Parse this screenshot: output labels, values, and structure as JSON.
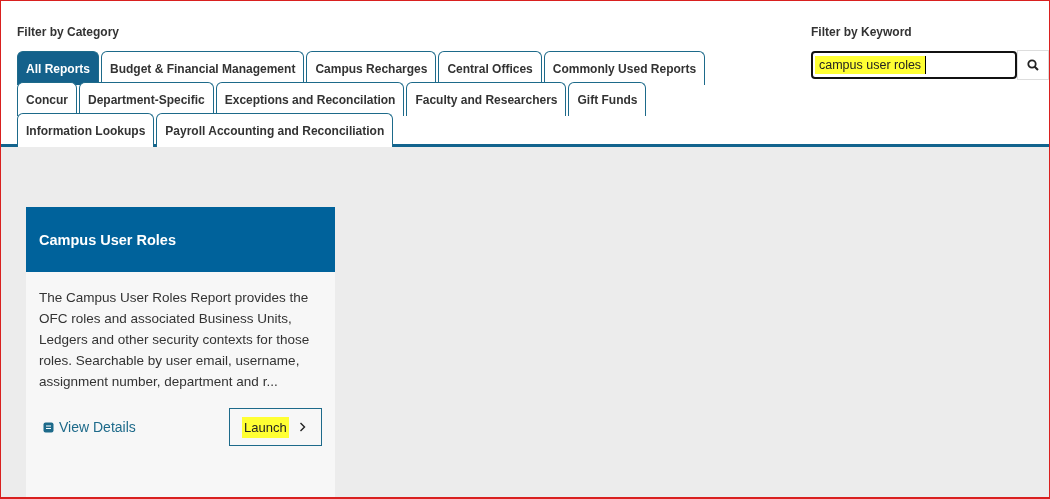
{
  "category_filter": {
    "label": "Filter by Category",
    "tabs": [
      {
        "label": "All Reports",
        "selected": true
      },
      {
        "label": "Budget & Financial Management",
        "selected": false
      },
      {
        "label": "Campus Recharges",
        "selected": false
      },
      {
        "label": "Central Offices",
        "selected": false
      },
      {
        "label": "Commonly Used Reports",
        "selected": false
      },
      {
        "label": "Concur",
        "selected": false
      },
      {
        "label": "Department-Specific",
        "selected": false
      },
      {
        "label": "Exceptions and Reconcilation",
        "selected": false
      },
      {
        "label": "Faculty and Researchers",
        "selected": false
      },
      {
        "label": "Gift Funds",
        "selected": false
      },
      {
        "label": "Information Lookups",
        "selected": false
      },
      {
        "label": "Payroll Accounting and Reconciliation",
        "selected": false
      }
    ]
  },
  "keyword_filter": {
    "label": "Filter by Keyword",
    "value": "campus user roles",
    "highlighted": true
  },
  "cards": [
    {
      "title": "Campus User Roles",
      "description": "The Campus User Roles Report provides the OFC roles and associated Business Units, Ledgers and other security contexts for those roles. Searchable by user email, username, assignment number, department and r...",
      "details_link": "View Details",
      "launch_button": "Launch",
      "launch_highlighted": true
    }
  ]
}
